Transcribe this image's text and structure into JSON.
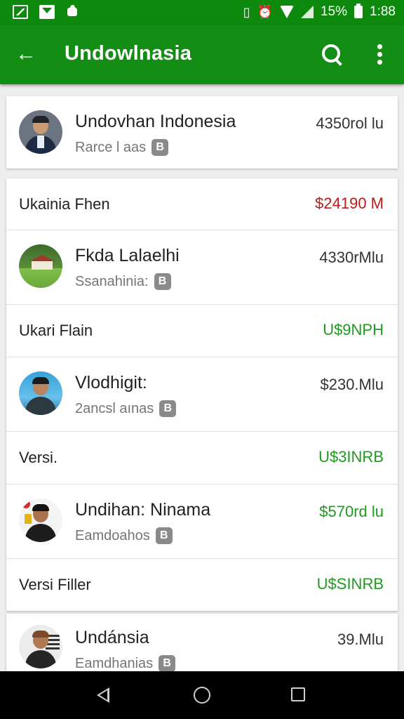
{
  "status_bar": {
    "battery_percent": "15%",
    "time": "1:88"
  },
  "app_bar": {
    "title": "Undowlnasia"
  },
  "header_card": {
    "name": "Undovhan Indonesia",
    "subtitle": "Rarce l aas",
    "badge": "B",
    "amount": "4350rol lu"
  },
  "items": [
    {
      "type": "summary",
      "label": "Ukainia Fhen",
      "value": "$24190 M",
      "value_color": "#b71c1c"
    },
    {
      "type": "person",
      "name": "Fkda Lalaelhi",
      "subtitle": "Ssanahinia:",
      "badge": "B",
      "amount": "4330rMlu",
      "amount_color": "#333333"
    },
    {
      "type": "summary",
      "label": "Ukari Flain",
      "value": "U$9NPH",
      "value_color": "#1e9a1e"
    },
    {
      "type": "person",
      "name": "Vlodhigit:",
      "subtitle": "2ancsl aınas",
      "badge": "B",
      "amount": "$230.Mlu",
      "amount_color": "#333333"
    },
    {
      "type": "summary",
      "label": "Versi.",
      "value": "U$3INRB",
      "value_color": "#1e9a1e"
    },
    {
      "type": "person",
      "name": "Undihan: Ninama",
      "subtitle": "Eamdoahos",
      "badge": "B",
      "amount": "$570rd lu",
      "amount_color": "#1e9a1e"
    },
    {
      "type": "summary",
      "label": "Versi Filler",
      "value": "U$SINRB",
      "value_color": "#1e9a1e"
    }
  ],
  "bottom_item": {
    "name": "Undánsia",
    "subtitle": "Eamdhanias",
    "badge": "B",
    "amount": "39.Mlu"
  }
}
